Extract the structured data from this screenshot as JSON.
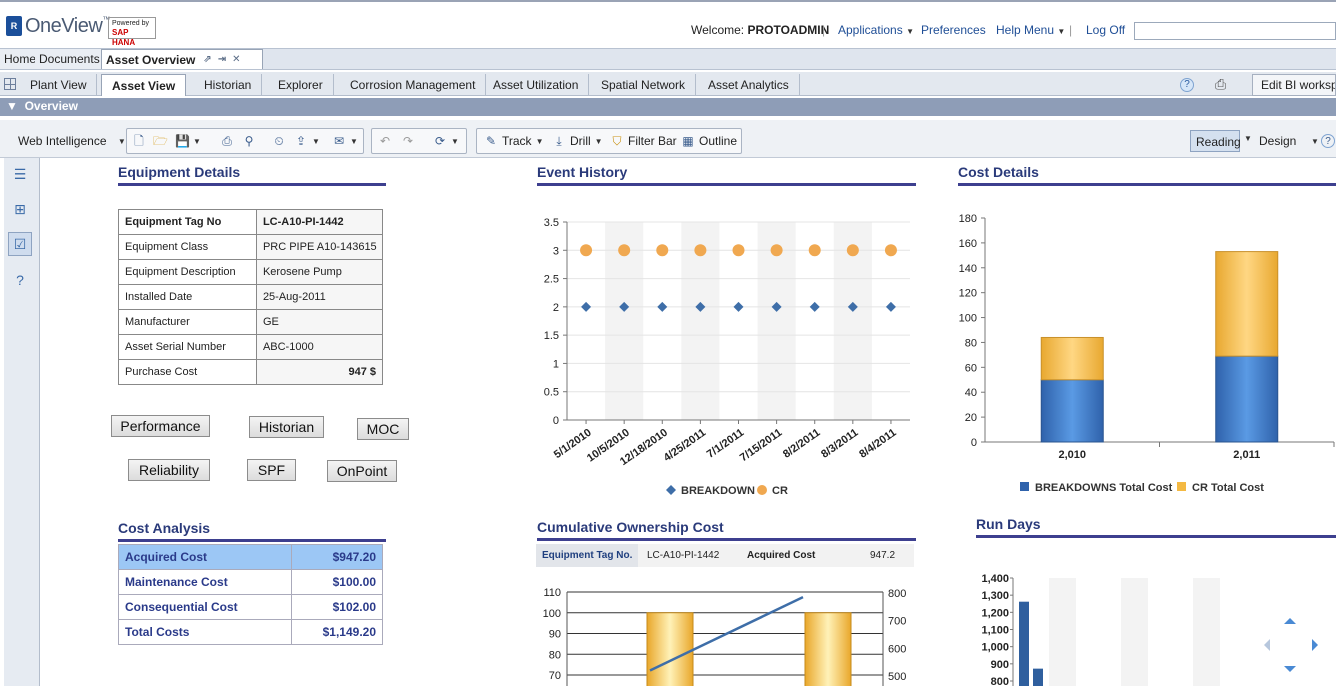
{
  "header": {
    "logo_text": "OneView",
    "logo_tm": "™",
    "logo_mark": "R",
    "powered_by": "Powered by",
    "powered_sap": "SAP HANA",
    "welcome_label": "Welcome: ",
    "username": "PROTOADMIN",
    "links": [
      "Applications",
      "Preferences",
      "Help Menu",
      "Log Off"
    ],
    "search_value": ""
  },
  "tabs1": {
    "home": "Home",
    "documents": "Documents",
    "asset_overview": "Asset Overview"
  },
  "tabs2": [
    "Plant View",
    "Asset View",
    "Historian",
    "Explorer",
    "Corrosion Management",
    "Asset Utilization",
    "Spatial Network",
    "Asset Analytics"
  ],
  "tabs2_active": "Asset View",
  "edit_bi": "Edit BI workspace",
  "overview_label": "Overview",
  "toolbar": {
    "web_intelligence": "Web Intelligence",
    "track": "Track",
    "drill": "Drill",
    "filter_bar": "Filter Bar",
    "outline": "Outline",
    "reading": "Reading",
    "design": "Design"
  },
  "equipment": {
    "title": "Equipment Details",
    "rows": [
      {
        "label": "Equipment Tag No",
        "value": "LC-A10-PI-1442"
      },
      {
        "label": "Equipment Class",
        "value": "PRC PIPE A10-143615"
      },
      {
        "label": "Equipment Description",
        "value": "Kerosene Pump"
      },
      {
        "label": "Installed Date",
        "value": "25-Aug-2011"
      },
      {
        "label": "Manufacturer",
        "value": "GE"
      },
      {
        "label": "Asset Serial Number",
        "value": "ABC-1000"
      },
      {
        "label": "Purchase Cost",
        "value": "947 $"
      }
    ]
  },
  "buttons": [
    "Performance",
    "Historian",
    "MOC",
    "Reliability",
    "SPF",
    "OnPoint"
  ],
  "cost_analysis": {
    "title": "Cost Analysis",
    "rows": [
      {
        "label": "Acquired Cost",
        "value": "$947.20"
      },
      {
        "label": "Maintenance Cost",
        "value": "$100.00"
      },
      {
        "label": "Consequential Cost",
        "value": "$102.00"
      },
      {
        "label": "Total Costs",
        "value": "$1,149.20"
      }
    ]
  },
  "event_history": {
    "title": "Event History"
  },
  "cost_details": {
    "title": "Cost Details"
  },
  "cumulative": {
    "title": "Cumulative Ownership Cost",
    "tag_label": "Equipment Tag No.",
    "tag_value": "LC-A10-PI-1442",
    "acq_label": "Acquired Cost",
    "acq_value": "947.2"
  },
  "run_days": {
    "title": "Run Days"
  },
  "colors": {
    "accent": "#3d3f8f",
    "blue_bar": "#3b78c4",
    "orange_bar": "#f4b942",
    "diamond": "#3e6ea8",
    "circle": "#f0a850"
  },
  "chart_data": [
    {
      "type": "scatter",
      "title": "Event History",
      "x": [
        "5/1/2010",
        "10/5/2010",
        "12/18/2010",
        "4/25/2011",
        "7/1/2011",
        "7/15/2011",
        "8/2/2011",
        "8/3/2011",
        "8/4/2011"
      ],
      "ylim": [
        0,
        3.5
      ],
      "yticks": [
        "0",
        "0.5",
        "1",
        "1.5",
        "2",
        "2.5",
        "3",
        "3.5"
      ],
      "series": [
        {
          "name": "BREAKDOWN",
          "values": [
            2,
            2,
            2,
            2,
            2,
            2,
            2,
            2,
            2
          ]
        },
        {
          "name": "CR",
          "values": [
            3,
            3,
            3,
            3,
            3,
            3,
            3,
            3,
            3
          ]
        }
      ],
      "legend": "bottom"
    },
    {
      "type": "bar",
      "title": "Cost Details",
      "categories": [
        "2,010",
        "2,011"
      ],
      "ylim": [
        0,
        180
      ],
      "yticks": [
        "0",
        "20",
        "40",
        "60",
        "80",
        "100",
        "120",
        "140",
        "160",
        "180"
      ],
      "series": [
        {
          "name": "BREAKDOWNS Total Cost",
          "values": [
            50,
            69
          ]
        },
        {
          "name": "CR Total Cost",
          "values": [
            34,
            84
          ]
        }
      ],
      "stacked": true,
      "legend": "bottom"
    },
    {
      "type": "bar",
      "title": "Cumulative Ownership Cost",
      "left_ylim": [
        70,
        110
      ],
      "left_yticks": [
        "70",
        "80",
        "90",
        "100",
        "110"
      ],
      "right_yticks": [
        "500",
        "600",
        "700",
        "800"
      ],
      "bar_values": [
        100,
        100
      ],
      "line_values": [
        520,
        785
      ]
    },
    {
      "type": "bar",
      "title": "Run Days",
      "yticks": [
        "800",
        "900",
        "1,000",
        "1,100",
        "1,200",
        "1,300",
        "1,400"
      ],
      "values": [
        1262,
        872
      ]
    }
  ]
}
